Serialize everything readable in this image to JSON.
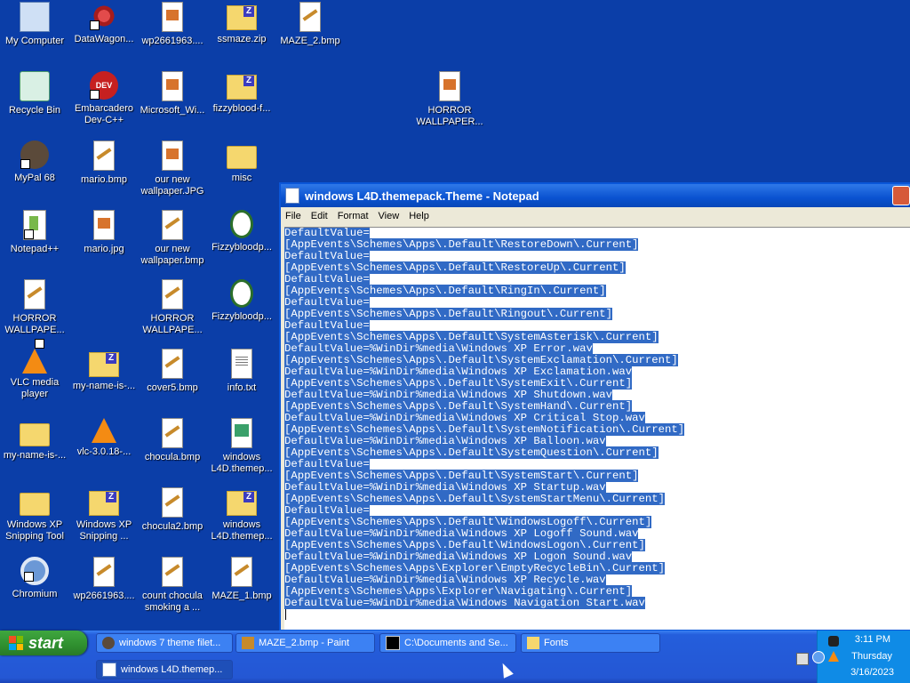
{
  "desktop": {
    "icons": [
      {
        "label": "My Computer",
        "icon": "computer-icon"
      },
      {
        "label": "DataWagon...",
        "icon": "datawagon-icon"
      },
      {
        "label": "wp2661963....",
        "icon": "image-file-icon"
      },
      {
        "label": "ssmaze.zip",
        "icon": "zip-folder-icon"
      },
      {
        "label": "MAZE_2.bmp",
        "icon": "paint-file-icon"
      },
      {
        "label": "Recycle Bin",
        "icon": "recycle-bin-icon"
      },
      {
        "label": "Embarcadero Dev-C++",
        "icon": "devcpp-icon"
      },
      {
        "label": "Microsoft_Wi...",
        "icon": "image-file-icon"
      },
      {
        "label": "fizzyblood-f...",
        "icon": "zip-folder-icon"
      },
      {
        "label": "HORROR WALLPAPER...",
        "icon": "image-file-icon"
      },
      {
        "label": "MyPal 68",
        "icon": "mypal-icon"
      },
      {
        "label": "mario.bmp",
        "icon": "paint-file-icon"
      },
      {
        "label": "our new wallpaper.JPG",
        "icon": "image-file-icon"
      },
      {
        "label": "misc",
        "icon": "folder-icon"
      },
      {
        "label": "Notepad++",
        "icon": "notepadpp-icon"
      },
      {
        "label": "mario.jpg",
        "icon": "image-file-icon"
      },
      {
        "label": "our new wallpaper.bmp",
        "icon": "paint-file-icon"
      },
      {
        "label": "Fizzybloodp...",
        "icon": "opera-icon"
      },
      {
        "label": "HORROR WALLPAPE...",
        "icon": "paint-file-icon"
      },
      {
        "label": "HORROR WALLPAPE...",
        "icon": "paint-file-icon"
      },
      {
        "label": "Fizzybloodp...",
        "icon": "opera-icon"
      },
      {
        "label": "VLC media player",
        "icon": "vlc-icon"
      },
      {
        "label": "my-name-is-...",
        "icon": "zip-folder-icon"
      },
      {
        "label": "cover5.bmp",
        "icon": "paint-file-icon"
      },
      {
        "label": "info.txt",
        "icon": "text-file-icon"
      },
      {
        "label": "my-name-is-...",
        "icon": "folder-icon"
      },
      {
        "label": "vlc-3.0.18-...",
        "icon": "vlc-icon"
      },
      {
        "label": "chocula.bmp",
        "icon": "paint-file-icon"
      },
      {
        "label": "windows L4D.themep...",
        "icon": "theme-file-icon"
      },
      {
        "label": "Windows XP Snipping Tool",
        "icon": "folder-icon"
      },
      {
        "label": "Windows XP Snipping ...",
        "icon": "zip-folder-icon"
      },
      {
        "label": "chocula2.bmp",
        "icon": "paint-file-icon"
      },
      {
        "label": "windows L4D.themep...",
        "icon": "zip-folder-icon"
      },
      {
        "label": "Chromium",
        "icon": "chromium-icon"
      },
      {
        "label": "wp2661963....",
        "icon": "paint-file-icon"
      },
      {
        "label": "count chocula smoking a ...",
        "icon": "paint-file-icon"
      },
      {
        "label": "MAZE_1.bmp",
        "icon": "paint-file-icon"
      }
    ]
  },
  "notepad": {
    "title": "windows L4D.themepack.Theme - Notepad",
    "menu": [
      "File",
      "Edit",
      "Format",
      "View",
      "Help"
    ],
    "lines": [
      "DefaultValue=",
      "[AppEvents\\Schemes\\Apps\\.Default\\RestoreDown\\.Current]",
      "DefaultValue=",
      "[AppEvents\\Schemes\\Apps\\.Default\\RestoreUp\\.Current]",
      "DefaultValue=",
      "[AppEvents\\Schemes\\Apps\\.Default\\RingIn\\.Current]",
      "DefaultValue=",
      "[AppEvents\\Schemes\\Apps\\.Default\\Ringout\\.Current]",
      "DefaultValue=",
      "[AppEvents\\Schemes\\Apps\\.Default\\SystemAsterisk\\.Current]",
      "DefaultValue=%WinDir%media\\Windows XP Error.wav",
      "[AppEvents\\Schemes\\Apps\\.Default\\SystemExclamation\\.Current]",
      "DefaultValue=%WinDir%media\\Windows XP Exclamation.wav",
      "[AppEvents\\Schemes\\Apps\\.Default\\SystemExit\\.Current]",
      "DefaultValue=%WinDir%media\\Windows XP Shutdown.wav",
      "[AppEvents\\Schemes\\Apps\\.Default\\SystemHand\\.Current]",
      "DefaultValue=%WinDir%media\\Windows XP Critical Stop.wav",
      "[AppEvents\\Schemes\\Apps\\.Default\\SystemNotification\\.Current]",
      "DefaultValue=%WinDir%media\\Windows XP Balloon.wav",
      "[AppEvents\\Schemes\\Apps\\.Default\\SystemQuestion\\.Current]",
      "DefaultValue=",
      "[AppEvents\\Schemes\\Apps\\.Default\\SystemStart\\.Current]",
      "DefaultValue=%WinDir%media\\Windows XP Startup.wav",
      "[AppEvents\\Schemes\\Apps\\.Default\\SystemStartMenu\\.Current]",
      "DefaultValue=",
      "[AppEvents\\Schemes\\Apps\\.Default\\WindowsLogoff\\.Current]",
      "DefaultValue=%WinDir%media\\Windows XP Logoff Sound.wav",
      "[AppEvents\\Schemes\\Apps\\.Default\\WindowsLogon\\.Current]",
      "DefaultValue=%WinDir%media\\Windows XP Logon Sound.wav",
      "[AppEvents\\Schemes\\Apps\\Explorer\\EmptyRecycleBin\\.Current]",
      "DefaultValue=%WinDir%media\\Windows XP Recycle.wav",
      "[AppEvents\\Schemes\\Apps\\Explorer\\Navigating\\.Current]",
      "DefaultValue=%WinDir%media\\Windows Navigation Start.wav"
    ]
  },
  "taskbar": {
    "start_label": "start",
    "buttons": [
      {
        "label": "windows 7 theme filet...",
        "icon": "mypal-icon"
      },
      {
        "label": "MAZE_2.bmp - Paint",
        "icon": "paint-icon"
      },
      {
        "label": "C:\\Documents and Se...",
        "icon": "cmd-icon"
      },
      {
        "label": "Fonts",
        "icon": "folder-icon"
      },
      {
        "label": "windows L4D.themep...",
        "icon": "notepad-icon"
      }
    ],
    "clock": {
      "time": "3:11 PM",
      "day": "Thursday",
      "date": "3/16/2023"
    }
  },
  "colors": {
    "desktop_bg": "#0b3ea8",
    "selection": "#316ac5",
    "titlebar": "#0a52d0",
    "taskbar": "#245edc",
    "start_green": "#2f8f2f"
  }
}
